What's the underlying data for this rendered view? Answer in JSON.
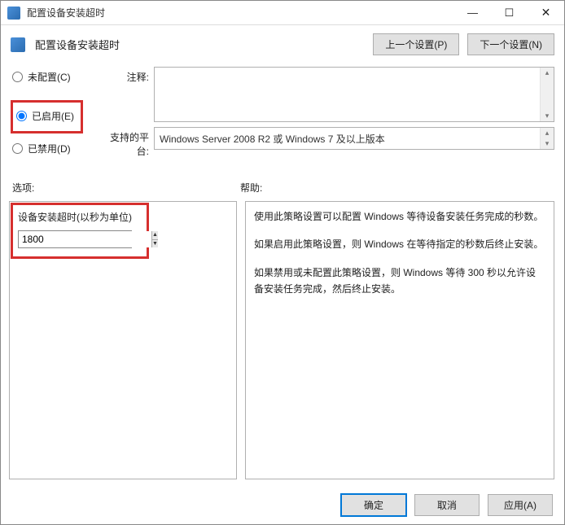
{
  "titlebar": {
    "title": "配置设备安装超时"
  },
  "win_controls": {
    "minimize": "—",
    "maximize": "☐",
    "close": "✕"
  },
  "header": {
    "title": "配置设备安装超时",
    "prev_btn": "上一个设置(P)",
    "next_btn": "下一个设置(N)"
  },
  "radio": {
    "not_configured": "未配置(C)",
    "enabled": "已启用(E)",
    "disabled": "已禁用(D)"
  },
  "fields": {
    "annotation_label": "注释:",
    "annotation_value": "",
    "platform_label": "支持的平台:",
    "platform_value": "Windows Server 2008 R2 或 Windows 7 及以上版本"
  },
  "columns": {
    "options_label": "选项:",
    "help_label": "帮助:"
  },
  "options": {
    "timeout_label": "设备安装超时(以秒为单位)",
    "timeout_value": "1800"
  },
  "help": {
    "p1": "使用此策略设置可以配置 Windows 等待设备安装任务完成的秒数。",
    "p2": "如果启用此策略设置，则 Windows 在等待指定的秒数后终止安装。",
    "p3": "如果禁用或未配置此策略设置，则 Windows 等待 300 秒以允许设备安装任务完成，然后终止安装。"
  },
  "footer": {
    "ok": "确定",
    "cancel": "取消",
    "apply": "应用(A)"
  }
}
